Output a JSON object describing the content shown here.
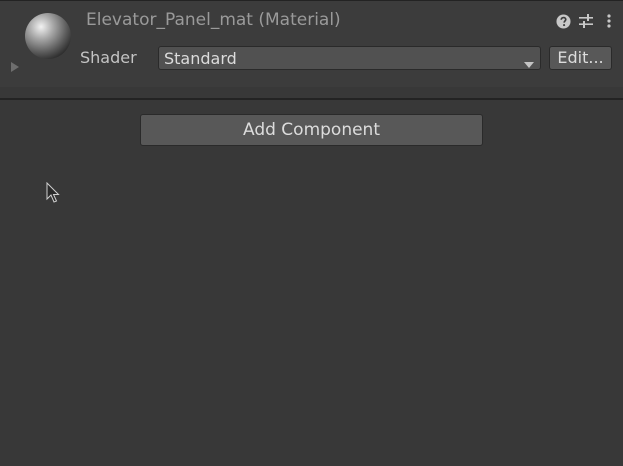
{
  "window": {
    "title": "Elevator_Panel_mat (Material)"
  },
  "header": {
    "icons": [
      "help-icon",
      "preset-sliders-icon",
      "kebab-menu-icon"
    ]
  },
  "shader": {
    "label": "Shader",
    "selected": "Standard",
    "edit_label": "Edit..."
  },
  "add_component": {
    "label": "Add Component"
  },
  "colors": {
    "background": "#383838",
    "header": "#3c3c3c",
    "button": "#585858",
    "field": "#515151",
    "text": "#c4c4c4"
  }
}
